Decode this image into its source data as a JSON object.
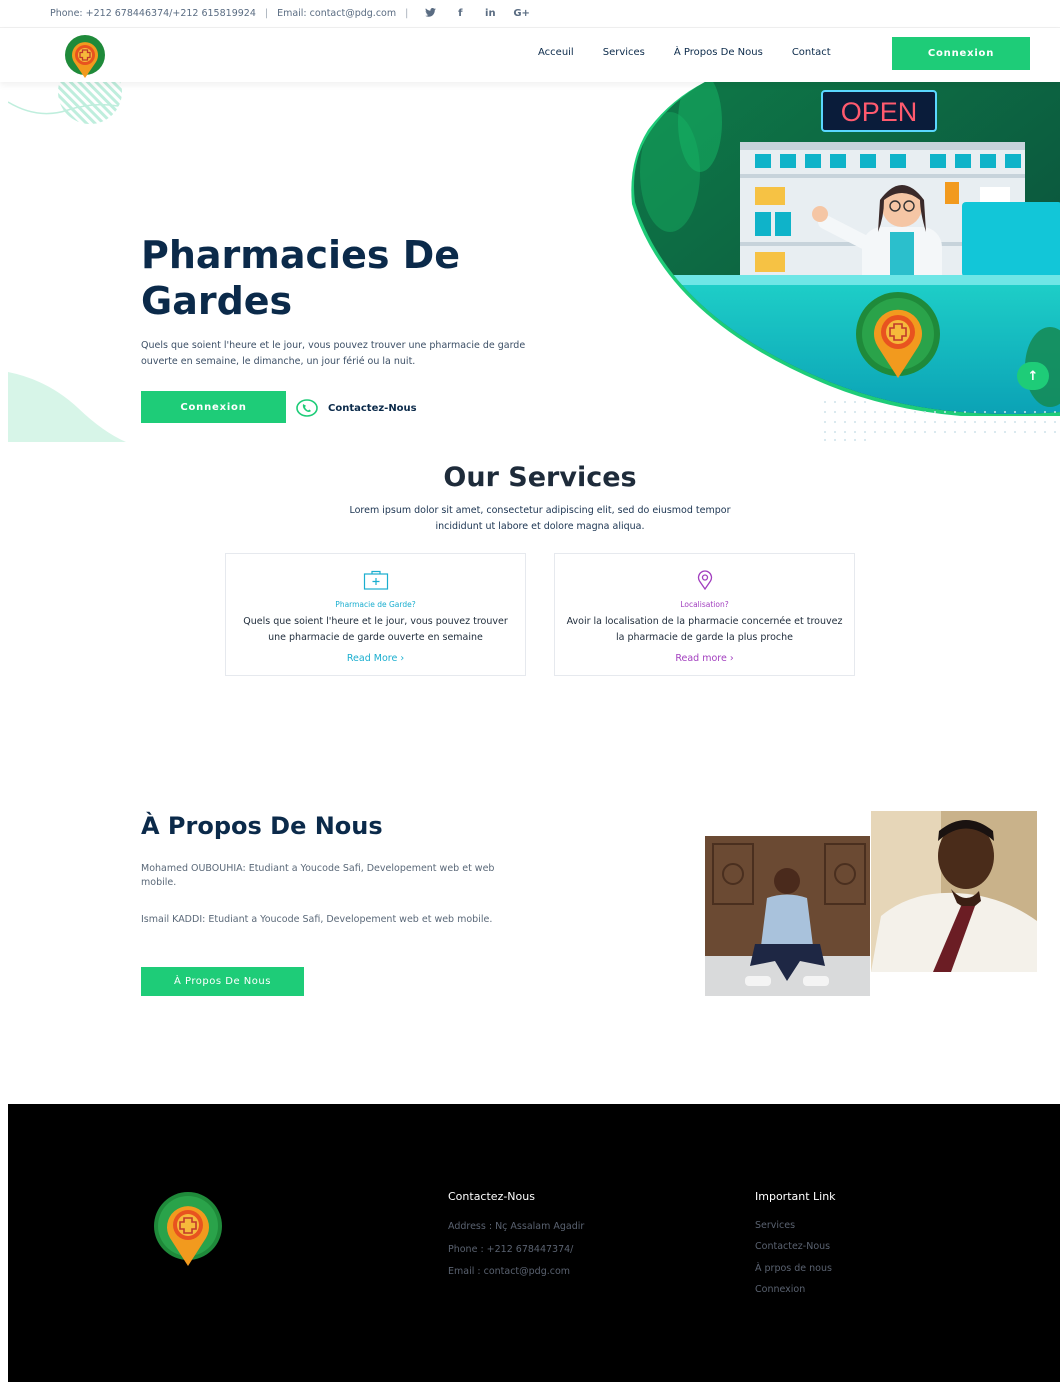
{
  "topbar": {
    "phone": "Phone: +212 678446374/+212 615819924",
    "email": "Email: contact@pdg.com",
    "social": {
      "twitter": "t",
      "facebook": "f",
      "linkedin": "in",
      "google": "G+"
    }
  },
  "nav": {
    "links": [
      "Acceuil",
      "Services",
      "À Propos De Nous",
      "Contact"
    ],
    "login": "Connexion"
  },
  "hero": {
    "title_line1": "Pharmacies De",
    "title_line2": "Gardes",
    "description": "Quels que soient l'heure et le jour, vous pouvez trouver une pharmacie de garde ouverte en semaine, le dimanche, un jour férié ou la nuit.",
    "login": "Connexion",
    "contact": "Contactez-Nous",
    "sign": "OPEN"
  },
  "services": {
    "title": "Our Services",
    "subtitle": "Lorem ipsum dolor sit amet, consectetur adipiscing elit, sed do eiusmod tempor incididunt ut labore et dolore magna aliqua.",
    "cards": [
      {
        "title": "Pharmacie de Garde?",
        "text": "Quels que soient l'heure et le jour, vous pouvez trouver une pharmacie de garde ouverte en semaine",
        "more": "Read More ›",
        "color": "#1aaecf"
      },
      {
        "title": "Localisation?",
        "text": "Avoir la localisation de la pharmacie concernée et trouvez la pharmacie de garde la plus proche",
        "more": "Read more ›",
        "color": "#a23fbf"
      }
    ]
  },
  "about": {
    "title": "À Propos De Nous",
    "p1": "Mohamed OUBOUHIA: Etudiant a Youcode Safi, Developement web et web mobile.",
    "p2": "Ismail KADDI: Etudiant a Youcode Safi, Developement web et web mobile.",
    "button": "À Propos De Nous"
  },
  "footer": {
    "contact_title": "Contactez-Nous",
    "address": "Address : Nç Assalam Agadir",
    "phone": "Phone : +212 678447374/",
    "email": "Email : contact@pdg.com",
    "links_title": "Important Link",
    "links": [
      "Services",
      "Contactez-Nous",
      "À prpos de nous",
      "Connexion"
    ]
  },
  "colors": {
    "accent": "#1ecc78",
    "navy": "#0b2a4a",
    "teal": "#0fa7a0"
  }
}
